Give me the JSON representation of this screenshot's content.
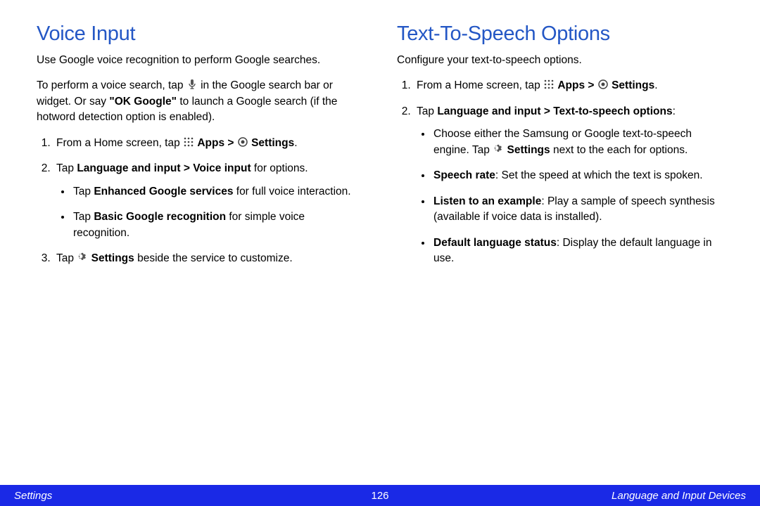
{
  "left": {
    "heading": "Voice Input",
    "intro": "Use Google voice recognition to perform Google searches.",
    "para2_a": "To perform a voice search, tap ",
    "para2_b": " in the Google search bar or widget. Or say ",
    "ok_google": "\"OK Google\"",
    "para2_c": " to launch a Google search (if the hotword detection option is enabled).",
    "step1_a": "From a Home screen, tap ",
    "apps": "Apps",
    "gt": " > ",
    "settings": "Settings",
    "period": ".",
    "step2_a": "Tap ",
    "step2_bold": "Language and input > Voice input",
    "step2_b": " for options.",
    "bullet1_a": "Tap ",
    "bullet1_bold": "Enhanced Google services",
    "bullet1_b": " for full voice interaction.",
    "bullet2_a": "Tap ",
    "bullet2_bold": "Basic Google recognition",
    "bullet2_b": " for simple voice recognition.",
    "step3_a": "Tap ",
    "step3_settings": "Settings",
    "step3_b": " beside the service to customize."
  },
  "right": {
    "heading": "Text-To-Speech Options",
    "intro": "Configure your text-to-speech options.",
    "step1_a": "From a Home screen, tap ",
    "apps": "Apps",
    "gt": " > ",
    "settings": "Settings",
    "period": ".",
    "step2_a": "Tap ",
    "step2_bold": "Language and input > Text-to-speech options",
    "colon": ":",
    "b1_a": "Choose either the Samsung or Google text-to-speech engine. Tap ",
    "b1_settings": "Settings",
    "b1_b": " next to the each for options.",
    "b2_bold": "Speech rate",
    "b2_b": ": Set the speed at which the text is spoken.",
    "b3_bold": "Listen to an example",
    "b3_b": ": Play a sample of speech synthesis (available if voice data is installed).",
    "b4_bold": "Default language status",
    "b4_b": ": Display the default language in use."
  },
  "footer": {
    "left": "Settings",
    "center": "126",
    "right": "Language and Input Devices"
  }
}
